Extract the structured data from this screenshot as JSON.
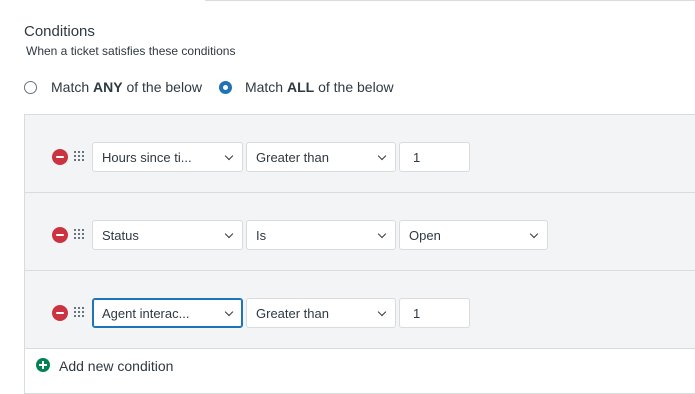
{
  "header": {
    "title": "Conditions",
    "subtitle": "When a ticket satisfies these conditions"
  },
  "match": {
    "any": {
      "prefix": "Match",
      "strong": "ANY",
      "suffix": "of the below",
      "selected": false
    },
    "all": {
      "prefix": "Match",
      "strong": "ALL",
      "suffix": "of the below",
      "selected": true
    }
  },
  "conditions": [
    {
      "field": "Hours since ti...",
      "operator": "Greater than",
      "value": "1",
      "value_type": "text"
    },
    {
      "field": "Status",
      "operator": "Is",
      "value": "Open",
      "value_type": "select"
    },
    {
      "field": "Agent interac...",
      "operator": "Greater than",
      "value": "1",
      "value_type": "text",
      "focused": true
    }
  ],
  "add_condition": {
    "label": "Add new condition"
  },
  "colors": {
    "accent": "#1f73b7",
    "remove": "#cc3340",
    "add": "#038153",
    "row_bg": "#f3f4f5",
    "border": "#d8dcde",
    "text": "#2f3941"
  },
  "icons": {
    "remove": "minus-circle-icon",
    "drag": "drag-grip-icon",
    "dropdown": "chevron-down-icon",
    "add": "plus-circle-icon"
  }
}
